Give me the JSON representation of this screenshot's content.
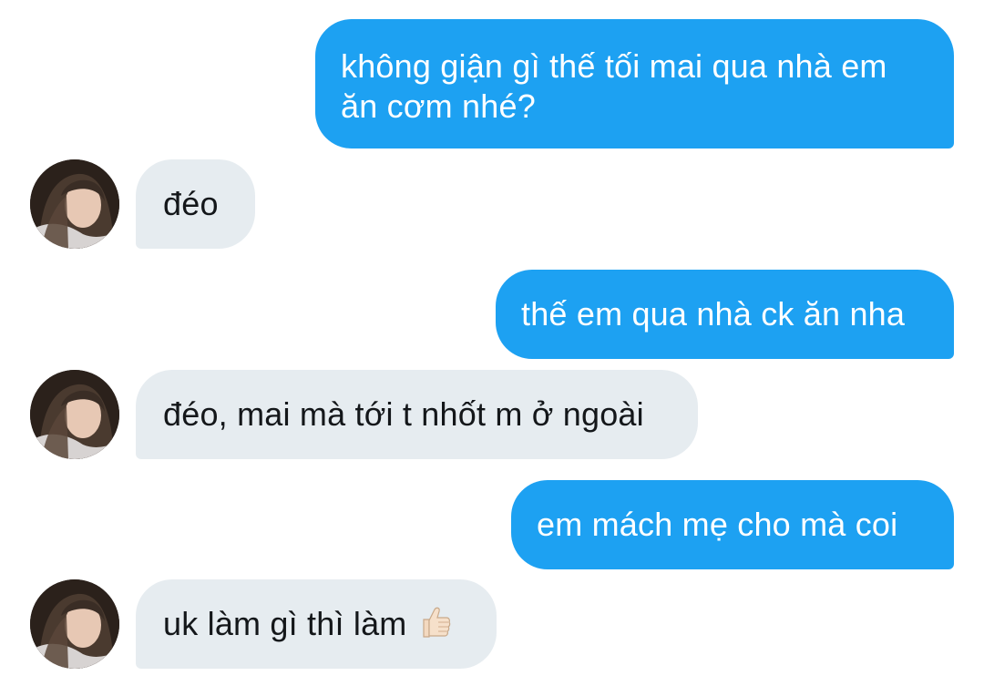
{
  "conversation": {
    "messages": [
      {
        "from": "me",
        "text_line1": "không giận gì thế tối mai qua nhà em",
        "text_line2": "ăn cơm nhé?"
      },
      {
        "from": "other",
        "text": "đéo"
      },
      {
        "from": "me",
        "text": "thế em qua nhà ck ăn nha"
      },
      {
        "from": "other",
        "text": "đéo, mai mà tới t nhốt m ở ngoài"
      },
      {
        "from": "me",
        "text": "em mách mẹ cho mà coi"
      },
      {
        "from": "other",
        "text": "uk làm gì thì làm",
        "emoji": "thumbs-up"
      }
    ]
  },
  "colors": {
    "outgoing_bubble": "#1da1f2",
    "incoming_bubble": "#e6ecf0",
    "incoming_text": "#14171a",
    "outgoing_text": "#ffffff"
  },
  "icons": {
    "avatar": "contact-avatar-photo",
    "emoji": "thumbs-up-icon"
  }
}
